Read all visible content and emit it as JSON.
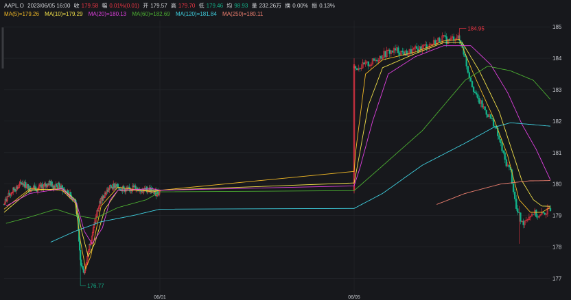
{
  "header": {
    "symbol": "AAPL.O",
    "datetime": "2023/06/05 16:00",
    "close_label": "收",
    "close_value": "179.58",
    "change_label": "幅",
    "change_value": "0.01%(0.01)",
    "open_label": "开",
    "open_value": "179.57",
    "high_label": "高",
    "high_value": "179.70",
    "low_label": "低",
    "low_value": "179.46",
    "avg_label": "均",
    "avg_value": "98.93",
    "volume_label": "量",
    "volume_value": "232.26万",
    "turnover_label": "换",
    "turnover_value": "0.00%",
    "amplitude_label": "振",
    "amplitude_value": "0.13%"
  },
  "ma_legend": [
    {
      "label": "MA(5)=179.26",
      "color": "#f4bb26"
    },
    {
      "label": "MA(10)=179.29",
      "color": "#f4e24a"
    },
    {
      "label": "MA(20)=180.13",
      "color": "#e040e0"
    },
    {
      "label": "MA(60)=182.69",
      "color": "#4caf32"
    },
    {
      "label": "MA(120)=181.84",
      "color": "#3fd0e0"
    },
    {
      "label": "MA(250)=180.11",
      "color": "#f08070"
    }
  ],
  "colors": {
    "up": "#f23645",
    "down": "#13b28a",
    "background": "#17181c",
    "grid": "#26272c",
    "axis_text": "#c9ccd2"
  },
  "chart_data": {
    "type": "candlestick",
    "y_axis": {
      "ticks": [
        177,
        178,
        179,
        180,
        181,
        182,
        183,
        184,
        185
      ],
      "range": [
        176.55,
        185.2
      ],
      "position": "right"
    },
    "x_axis": {
      "tick_labels": [
        "06/01",
        "06/05"
      ]
    },
    "annotations": {
      "high_label": "184.95",
      "low_label": "176.77"
    },
    "segments": [
      {
        "anchors": [
          [
            0,
            179.35
          ],
          [
            4,
            179.55
          ],
          [
            10,
            179.7
          ],
          [
            16,
            179.85
          ],
          [
            22,
            179.9
          ],
          [
            28,
            180.05
          ],
          [
            34,
            179.95
          ],
          [
            40,
            179.85
          ],
          [
            46,
            179.9
          ],
          [
            52,
            179.85
          ],
          [
            58,
            179.9
          ],
          [
            64,
            179.95
          ],
          [
            70,
            180.05
          ],
          [
            76,
            179.95
          ],
          [
            84,
            179.95
          ],
          [
            90,
            179.85
          ],
          [
            96,
            179.75
          ],
          [
            102,
            179.65
          ],
          [
            106,
            179.55
          ],
          [
            110,
            179.45
          ],
          [
            114,
            178.85
          ],
          [
            118,
            177.55
          ],
          [
            124,
            177.2
          ],
          [
            128,
            177.55
          ],
          [
            132,
            178.05
          ],
          [
            138,
            178.55
          ],
          [
            144,
            179.1
          ],
          [
            150,
            179.5
          ],
          [
            156,
            179.7
          ],
          [
            162,
            179.85
          ],
          [
            168,
            179.95
          ],
          [
            176,
            179.9
          ],
          [
            184,
            179.85
          ],
          [
            192,
            179.8
          ],
          [
            200,
            179.9
          ],
          [
            208,
            179.85
          ],
          [
            216,
            179.8
          ],
          [
            224,
            179.85
          ],
          [
            230,
            179.75
          ],
          [
            236,
            179.7
          ],
          [
            240,
            179.75
          ],
          [
            242,
            179.95
          ]
        ],
        "amp": 0.12
      },
      {
        "anchors": [
          [
            242,
            183.7
          ],
          [
            248,
            183.75
          ],
          [
            254,
            183.85
          ],
          [
            260,
            184.05
          ],
          [
            266,
            184.2
          ],
          [
            272,
            184.25
          ],
          [
            278,
            184.15
          ],
          [
            284,
            184.25
          ],
          [
            290,
            184.35
          ],
          [
            296,
            184.45
          ],
          [
            300,
            184.55
          ],
          [
            304,
            184.65
          ],
          [
            308,
            184.55
          ],
          [
            314,
            184.7
          ],
          [
            318,
            184.4
          ],
          [
            322,
            183.6
          ],
          [
            328,
            182.75
          ],
          [
            334,
            182.35
          ],
          [
            340,
            181.95
          ],
          [
            344,
            181.4
          ],
          [
            348,
            180.75
          ],
          [
            352,
            180.4
          ],
          [
            356,
            179.2
          ],
          [
            360,
            178.75
          ],
          [
            364,
            178.95
          ],
          [
            368,
            179.1
          ],
          [
            372,
            178.95
          ],
          [
            376,
            179.1
          ],
          [
            380,
            179.15
          ]
        ],
        "amp": 0.14
      }
    ],
    "ma_anchors": {
      "MA(5)": [
        [
          0,
          179.2
        ],
        [
          40,
          179.85
        ],
        [
          90,
          179.8
        ],
        [
          110,
          179.4
        ],
        [
          118,
          178.2
        ],
        [
          126,
          177.3
        ],
        [
          134,
          177.7
        ],
        [
          150,
          179.3
        ],
        [
          176,
          179.9
        ],
        [
          230,
          179.75
        ],
        [
          241,
          179.8
        ],
        [
          243,
          181.0
        ],
        [
          250,
          183.5
        ],
        [
          262,
          183.95
        ],
        [
          285,
          184.2
        ],
        [
          305,
          184.55
        ],
        [
          316,
          184.6
        ],
        [
          326,
          183.5
        ],
        [
          340,
          182.1
        ],
        [
          350,
          180.9
        ],
        [
          358,
          179.5
        ],
        [
          366,
          179.1
        ],
        [
          374,
          179.1
        ],
        [
          380,
          179.26
        ]
      ],
      "MA(10)": [
        [
          0,
          179.1
        ],
        [
          40,
          179.8
        ],
        [
          90,
          179.85
        ],
        [
          110,
          179.5
        ],
        [
          120,
          178.5
        ],
        [
          130,
          177.7
        ],
        [
          140,
          178.1
        ],
        [
          156,
          179.2
        ],
        [
          176,
          179.8
        ],
        [
          230,
          179.8
        ],
        [
          241,
          179.8
        ],
        [
          244,
          180.5
        ],
        [
          252,
          182.5
        ],
        [
          262,
          183.7
        ],
        [
          285,
          184.15
        ],
        [
          305,
          184.5
        ],
        [
          318,
          184.5
        ],
        [
          330,
          183.6
        ],
        [
          344,
          182.3
        ],
        [
          352,
          181.2
        ],
        [
          360,
          180.1
        ],
        [
          368,
          179.5
        ],
        [
          374,
          179.3
        ],
        [
          380,
          179.29
        ]
      ],
      "MA(20)": [
        [
          3,
          179.3
        ],
        [
          40,
          179.7
        ],
        [
          90,
          179.85
        ],
        [
          112,
          179.4
        ],
        [
          124,
          178.5
        ],
        [
          136,
          178.1
        ],
        [
          152,
          178.6
        ],
        [
          164,
          179.5
        ],
        [
          176,
          179.8
        ],
        [
          230,
          179.85
        ],
        [
          241,
          179.8
        ],
        [
          246,
          180.5
        ],
        [
          255,
          182.0
        ],
        [
          266,
          183.5
        ],
        [
          285,
          184.05
        ],
        [
          305,
          184.4
        ],
        [
          324,
          184.4
        ],
        [
          338,
          183.8
        ],
        [
          350,
          182.9
        ],
        [
          360,
          181.9
        ],
        [
          370,
          181.1
        ],
        [
          380,
          180.13
        ]
      ],
      "MA(60)": [
        [
          3,
          178.75
        ],
        [
          40,
          178.95
        ],
        [
          80,
          179.2
        ],
        [
          110,
          179.0
        ],
        [
          140,
          178.9
        ],
        [
          176,
          179.25
        ],
        [
          220,
          179.5
        ],
        [
          241,
          179.75
        ],
        [
          260,
          180.5
        ],
        [
          290,
          181.7
        ],
        [
          320,
          183.3
        ],
        [
          336,
          183.75
        ],
        [
          352,
          183.6
        ],
        [
          368,
          183.3
        ],
        [
          380,
          182.69
        ]
      ],
      "MA(120)": [
        [
          72,
          178.15
        ],
        [
          110,
          178.5
        ],
        [
          150,
          178.8
        ],
        [
          200,
          179.0
        ],
        [
          241,
          179.2
        ],
        [
          262,
          179.7
        ],
        [
          290,
          180.6
        ],
        [
          320,
          181.3
        ],
        [
          340,
          181.8
        ],
        [
          352,
          181.95
        ],
        [
          365,
          181.9
        ],
        [
          380,
          181.84
        ]
      ],
      "MA(250)": [
        [
          300,
          179.35
        ],
        [
          320,
          179.7
        ],
        [
          345,
          180.0
        ],
        [
          365,
          180.1
        ],
        [
          380,
          180.11
        ]
      ]
    },
    "series": [
      {
        "name": "MA(5)",
        "latest": 179.26
      },
      {
        "name": "MA(10)",
        "latest": 179.29
      },
      {
        "name": "MA(20)",
        "latest": 180.13
      },
      {
        "name": "MA(60)",
        "latest": 182.69
      },
      {
        "name": "MA(120)",
        "latest": 181.84
      },
      {
        "name": "MA(250)",
        "latest": 180.11
      }
    ]
  }
}
